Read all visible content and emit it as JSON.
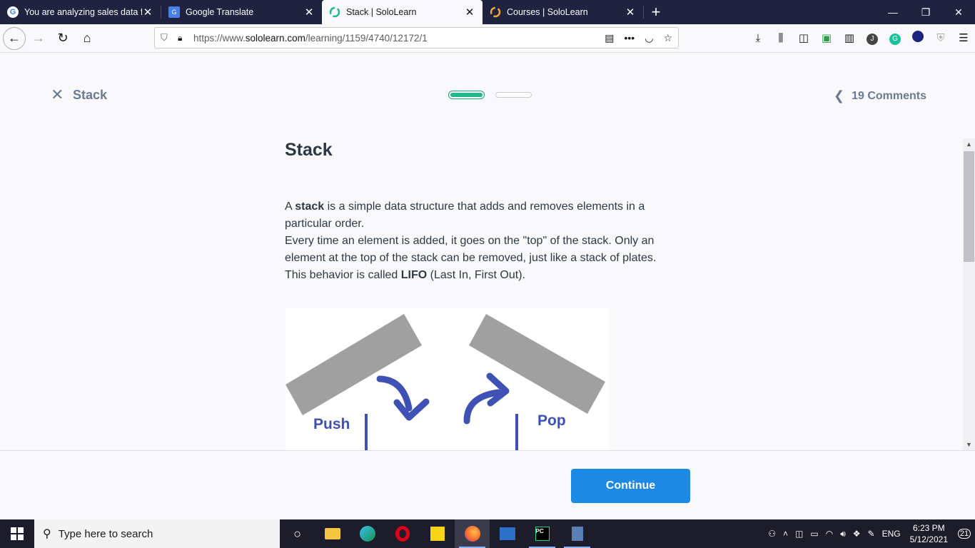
{
  "browser": {
    "tabs": [
      {
        "title": "You are analyzing sales data fro",
        "icon": "google-icon",
        "active": false
      },
      {
        "title": "Google Translate",
        "icon": "translate-icon",
        "active": false
      },
      {
        "title": "Stack | SoloLearn",
        "icon": "sololearn-icon",
        "active": true
      },
      {
        "title": "Courses | SoloLearn",
        "icon": "sololearn-icon",
        "active": false
      }
    ],
    "url_prefix": "https://www.",
    "url_domain": "sololearn.com",
    "url_path": "/learning/1159/4740/12172/1"
  },
  "lesson": {
    "name": "Stack",
    "comments_label": "19 Comments",
    "progress": {
      "current": 1,
      "total": 2
    }
  },
  "content": {
    "heading": "Stack",
    "para_a": "A ",
    "para_b": "stack",
    "para_c": " is a simple data structure that adds and removes elements in a particular order.\nEvery time an element is added, it goes on the \"top\" of the stack. Only an element at the top of the stack can be removed, just like a stack of plates.\nThis behavior is called ",
    "para_d": "LIFO",
    "para_e": " (Last In, First Out).",
    "image_push_label": "Push",
    "image_pop_label": "Pop"
  },
  "footer": {
    "continue_label": "Continue"
  },
  "taskbar": {
    "search_placeholder": "Type here to search",
    "lang": "ENG",
    "time": "6:23 PM",
    "date": "5/12/2021",
    "notifications": "21"
  },
  "colors": {
    "accent": "#1e88e5",
    "progress": "#1fb890",
    "illustration_blue": "#3f51b5"
  }
}
